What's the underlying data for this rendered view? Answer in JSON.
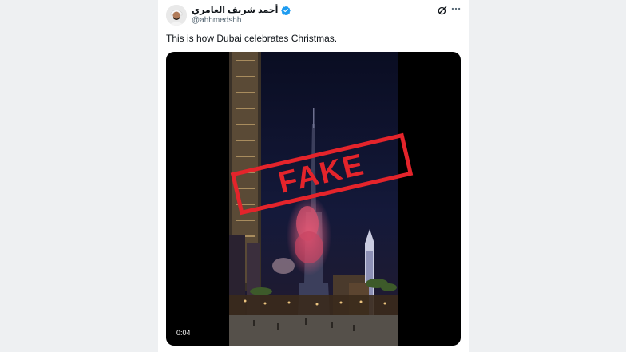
{
  "tweet": {
    "display_name": "أحمد شريف العامري",
    "handle": "@ahhmedshh",
    "text": "This is how Dubai celebrates Christmas.",
    "video": {
      "timestamp": "0:04",
      "stamp_label": "FAKE"
    }
  },
  "colors": {
    "verified": "#1d9bf0",
    "stamp": "#e4242b",
    "text": "#0f1419",
    "muted": "#536471"
  },
  "icons": [
    "verified-badge-icon",
    "grok-icon",
    "more-options-icon"
  ]
}
